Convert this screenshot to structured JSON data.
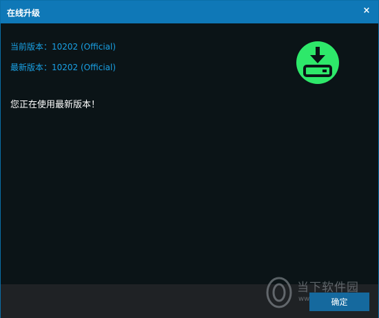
{
  "window": {
    "title": "在线升级",
    "close_glyph": "×"
  },
  "info": {
    "current_version": "当前版本：10202 (Official)",
    "latest_version": "最新版本：10202 (Official)"
  },
  "message": "您正在使用最新版本！",
  "icon": {
    "name": "download-icon",
    "color": "#2ee86a"
  },
  "footer": {
    "ok_label": "确定"
  },
  "watermark": {
    "text": "当下软件园",
    "url": "www.downxia.com"
  },
  "colors": {
    "titlebar": "#0f78b7",
    "background": "#0b1417",
    "link_text": "#1aa2e6",
    "button": "#15699e",
    "footer": "#1f2225"
  }
}
